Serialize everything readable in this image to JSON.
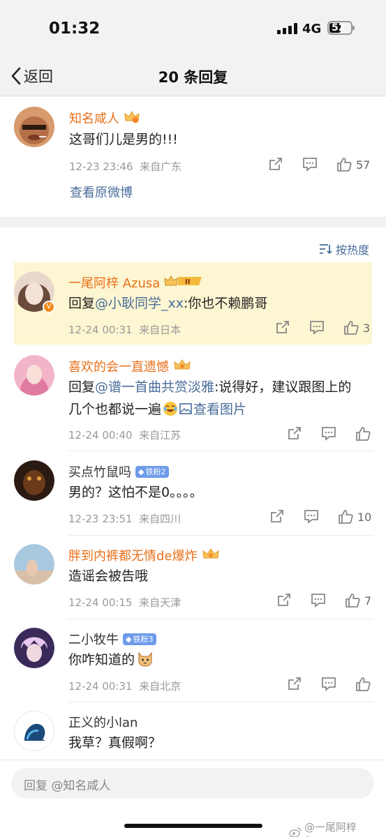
{
  "status": {
    "time": "01:32",
    "network": "4G",
    "battery": "52",
    "battery_level": 0.52
  },
  "nav": {
    "back_label": "返回",
    "title": "20 条回复"
  },
  "root": {
    "name": "知名咸人",
    "text": "这哥们儿是男的!!!",
    "time": "12-23 23:46",
    "source": "来自广东",
    "likes": "57",
    "view_original": "查看原微博"
  },
  "sort_label": "按热度",
  "replies": [
    {
      "name": "一尾阿梓 Azusa",
      "prefix": "回复",
      "mention": "@小耿同学_xx",
      "text": ":你也不赖鹏哥",
      "time": "12-24 00:31",
      "source": "来自日本",
      "likes": "3"
    },
    {
      "name": "喜欢的会一直遗憾",
      "prefix": "回复",
      "mention": "@谱一首曲共赏淡雅",
      "text": ":说得好，建议跟图上的几个也都说一遍",
      "view_image": "查看图片",
      "time": "12-24 00:40",
      "source": "来自江苏",
      "likes": ""
    },
    {
      "name": "买点竹鼠吗",
      "badge": "铁粉2",
      "text": "男的？这怕不是0。。。。",
      "time": "12-23 23:51",
      "source": "来自四川",
      "likes": "10"
    },
    {
      "name": "胖到内裤都无情de爆炸",
      "text": "造谣会被告哦",
      "time": "12-24 00:15",
      "source": "来自天津",
      "likes": "7"
    },
    {
      "name": "二小牧牛",
      "badge": "铁粉3",
      "text": "你咋知道的",
      "time": "12-24 00:31",
      "source": "来自北京",
      "likes": ""
    },
    {
      "name": "正义的小lan",
      "text": "我草？真假啊？"
    }
  ],
  "reply_input": {
    "placeholder": "回复 @知名咸人"
  },
  "watermark": "@一尾阿梓Azusa",
  "colors": {
    "orange_name": "#e8701a",
    "link_blue": "#4a6d9a",
    "highlight_bg": "#fdf6d2",
    "fan_badge": "#6e9bea"
  }
}
